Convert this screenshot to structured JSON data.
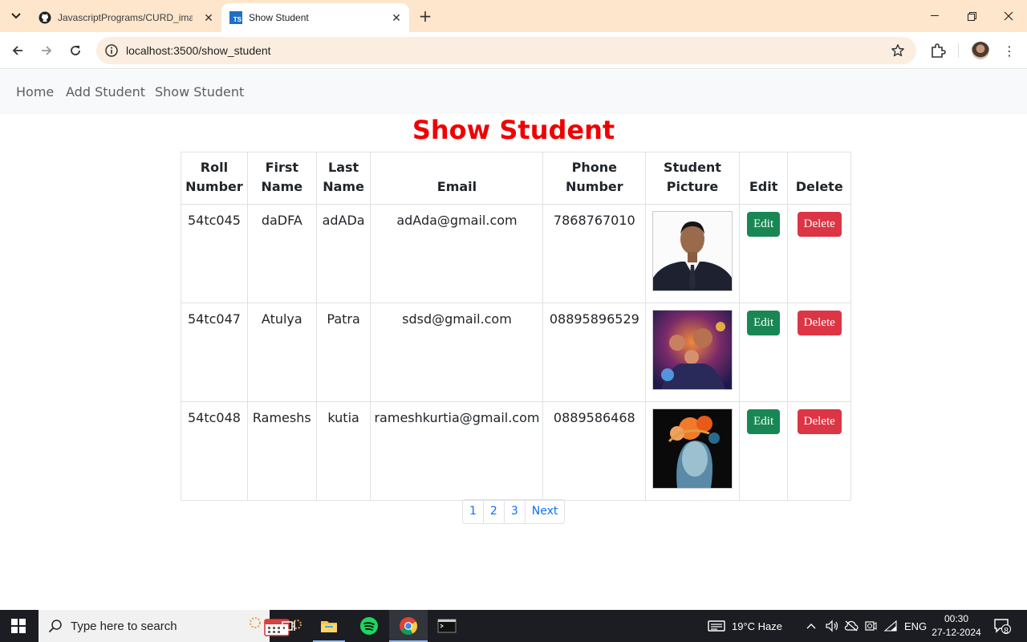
{
  "browser": {
    "tabs": [
      {
        "title": "JavascriptPrograms/CURD_image",
        "active": false,
        "favicon": "github-icon"
      },
      {
        "title": "Show Student",
        "active": true,
        "favicon": "typescript-icon"
      }
    ],
    "url": "localhost:3500/show_student"
  },
  "navbar": {
    "links": [
      "Home",
      "Add Student",
      "Show Student"
    ]
  },
  "page": {
    "title": "Show Student",
    "title_color": "#f00000"
  },
  "table": {
    "headers": {
      "roll": [
        "Roll",
        "Number"
      ],
      "first": [
        "First",
        "Name"
      ],
      "last": [
        "Last",
        "Name"
      ],
      "email": "Email",
      "phone": [
        "Phone",
        "Number"
      ],
      "picture": [
        "Student",
        "Picture"
      ],
      "edit": "Edit",
      "delete": "Delete"
    },
    "rows": [
      {
        "roll": "54tc045",
        "first": "daDFA",
        "last": "adADa",
        "email": "adAda@gmail.com",
        "phone": "7868767010",
        "edit": "Edit",
        "delete": "Delete"
      },
      {
        "roll": "54tc047",
        "first": "Atulya",
        "last": "Patra",
        "email": "sdsd@gmail.com",
        "phone": "08895896529",
        "edit": "Edit",
        "delete": "Delete"
      },
      {
        "roll": "54tc048",
        "first": "Rameshs",
        "last": "kutia",
        "email": "rameshkurtia@gmail.com",
        "phone": "0889586468",
        "edit": "Edit",
        "delete": "Delete"
      }
    ]
  },
  "pagination": {
    "pages": [
      "1",
      "2",
      "3"
    ],
    "next": "Next"
  },
  "taskbar": {
    "search_placeholder": "Type here to search",
    "weather": "19°C  Haze",
    "language": "ENG",
    "time": "00:30",
    "date": "27-12-2024",
    "notifications": "8"
  },
  "colors": {
    "edit_button": "#198754",
    "delete_button": "#dc3545",
    "link": "#0d6efd",
    "tabbar": "#fde6cc"
  }
}
